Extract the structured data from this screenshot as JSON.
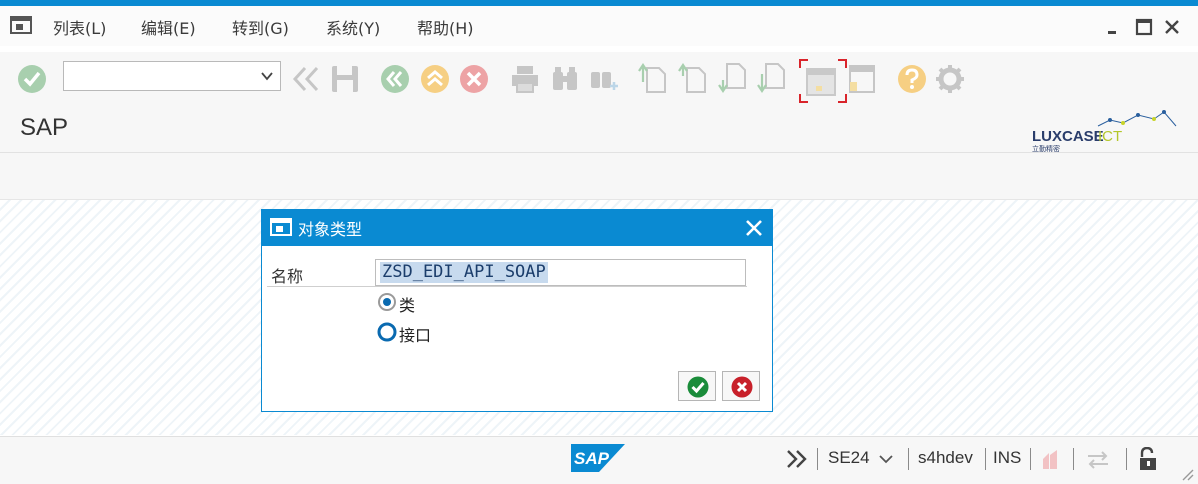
{
  "menu": {
    "items": [
      "列表(L)",
      "编辑(E)",
      "转到(G)",
      "系统(Y)",
      "帮助(H)"
    ]
  },
  "toolbar": {
    "command_field_value": ""
  },
  "screen": {
    "title": "SAP",
    "logo_text": "LUXCASE",
    "logo_text_accent": "ICT",
    "logo_subtext": "立勤精密"
  },
  "dialog": {
    "title": "对象类型",
    "name_label": "名称",
    "name_value": "ZSD_EDI_API_SOAP",
    "radio_options": [
      {
        "label": "类",
        "selected": true
      },
      {
        "label": "接口",
        "selected": false
      }
    ]
  },
  "status": {
    "transaction": "SE24",
    "system": "s4hdev",
    "mode": "INS"
  },
  "colors": {
    "accent": "#0a8ad2",
    "confirm_green": "#1a8c3a",
    "cancel_red": "#c8202a"
  }
}
